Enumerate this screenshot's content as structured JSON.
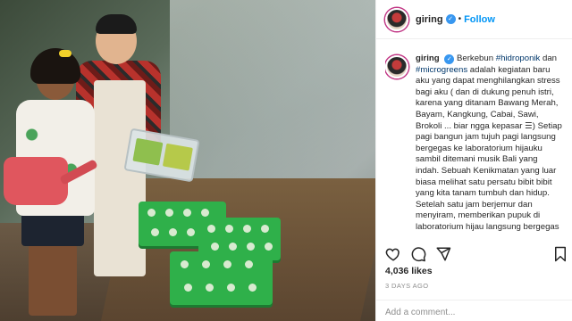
{
  "post": {
    "username": "giring",
    "follow_label": "Follow",
    "verified_mark": "✓",
    "dot": "•",
    "caption": {
      "t1": "Berkebun ",
      "tag1": "#hidroponik",
      "t2": " dan ",
      "tag2": "#microgreens",
      "t3": " adalah kegiatan baru aku yang dapat menghilangkan stress bagi aku ( dan di dukung penuh istri, karena yang ditanam Bawang Merah, Bayam, Kangkung, Cabai, Sawi, Brokoli ... biar ngga kepasar ☰) Setiap pagi bangun jam tujuh pagi langsung bergegas ke laboratorium hijauku sambil ditemani musik Bali yang indah. Sebuah Kenikmatan yang luar biasa melihat satu persatu bibit bibit yang kita tanam tumbuh dan hidup. Setelah satu jam berjemur dan menyiram, memberikan pupuk di laboratorium hijau langsung bergegas"
    },
    "likes": "4,036 likes",
    "time_ago": "3 DAYS AGO",
    "comment_placeholder": "Add a comment..."
  },
  "icons": [
    "heart-icon",
    "comment-icon",
    "share-icon",
    "bookmark-icon"
  ],
  "colors": {
    "accent": "#0095f6",
    "verified": "#3897f0",
    "hashtag": "#00376b",
    "muted": "#8e8e8e",
    "tray_green": "#2fb04a"
  }
}
